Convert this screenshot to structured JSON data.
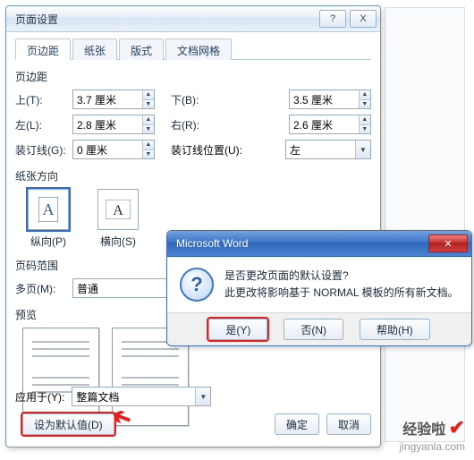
{
  "pageSetup": {
    "title": "页面设置",
    "help": "?",
    "close": "X",
    "tabs": [
      "页边距",
      "纸张",
      "版式",
      "文档网格"
    ],
    "margins": {
      "title": "页边距",
      "top_label": "上(T):",
      "top": "3.7 厘米",
      "bottom_label": "下(B):",
      "bottom": "3.5 厘米",
      "left_label": "左(L):",
      "left": "2.8 厘米",
      "right_label": "右(R):",
      "right": "2.6 厘米",
      "gutter_label": "装订线(G):",
      "gutter": "0 厘米",
      "gutter_pos_label": "装订线位置(U):",
      "gutter_pos": "左"
    },
    "orientation": {
      "title": "纸张方向",
      "portrait": "纵向(P)",
      "landscape": "横向(S)"
    },
    "pages": {
      "title": "页码范围",
      "multi_label": "多页(M):",
      "multi": "普通"
    },
    "preview_title": "预览",
    "apply_label": "应用于(Y):",
    "apply_value": "整篇文档",
    "default_btn": "设为默认值(D)",
    "ok": "确定",
    "cancel": "取消"
  },
  "msgbox": {
    "title": "Microsoft Word",
    "line1": "是否更改页面的默认设置?",
    "line2": "此更改将影响基于 NORMAL 模板的所有新文档。",
    "yes": "是(Y)",
    "no": "否(N)",
    "help": "帮助(H)"
  },
  "footer": {
    "zh": "经验啦",
    "en": "jingyanla.com"
  }
}
